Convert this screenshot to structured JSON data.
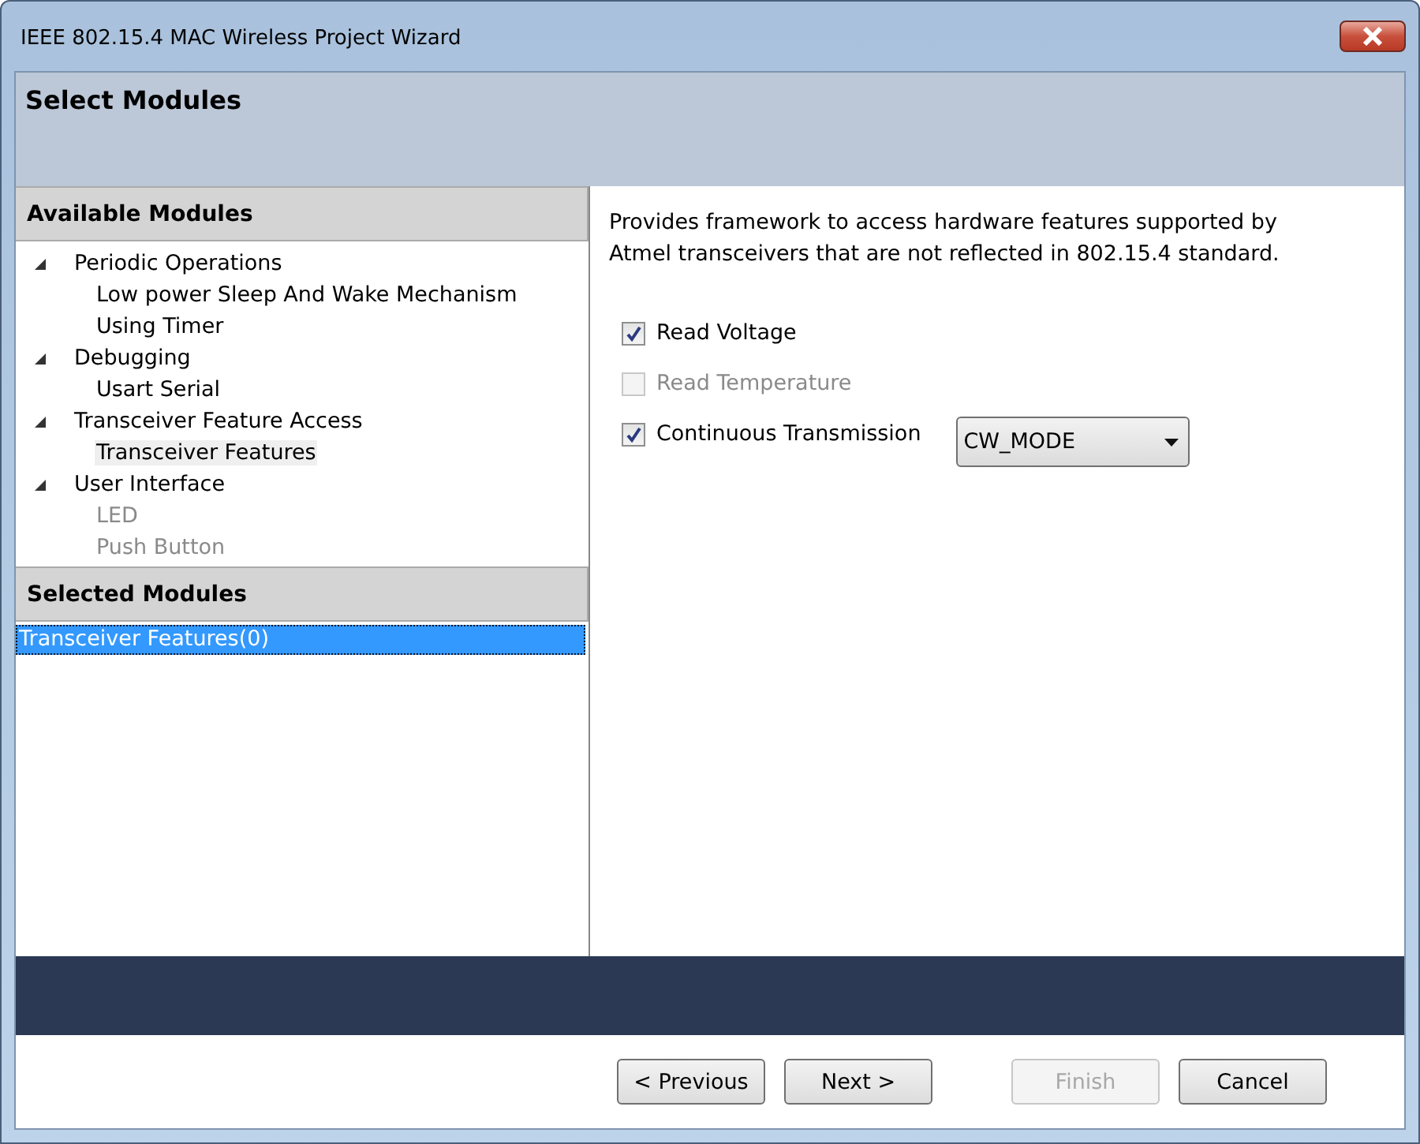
{
  "window": {
    "title": "IEEE 802.15.4 MAC Wireless Project Wizard"
  },
  "page_title": "Select Modules",
  "available_modules": {
    "title": "Available Modules",
    "items": [
      {
        "label": "Periodic Operations",
        "expanded": true,
        "children": [
          {
            "label": "Low power Sleep And Wake Mechanism",
            "disabled": false,
            "selected": false
          },
          {
            "label": "Using Timer",
            "disabled": false,
            "selected": false
          }
        ]
      },
      {
        "label": "Debugging",
        "expanded": true,
        "children": [
          {
            "label": "Usart Serial",
            "disabled": false,
            "selected": false
          }
        ]
      },
      {
        "label": "Transceiver Feature Access",
        "expanded": true,
        "children": [
          {
            "label": "Transceiver Features",
            "disabled": false,
            "selected": true
          }
        ]
      },
      {
        "label": "User Interface",
        "expanded": true,
        "children": [
          {
            "label": "LED",
            "disabled": true,
            "selected": false
          },
          {
            "label": "Push Button",
            "disabled": true,
            "selected": false
          }
        ]
      }
    ]
  },
  "selected_modules": {
    "title": "Selected Modules",
    "items": [
      {
        "label": "Transceiver Features(0)",
        "selected": true
      }
    ]
  },
  "description": "Provides framework to access hardware features supported by\nAtmel transceivers that are not reflected in 802.15.4 standard.",
  "options": [
    {
      "label": "Read Voltage",
      "checked": true,
      "disabled": false
    },
    {
      "label": "Read Temperature",
      "checked": false,
      "disabled": true
    },
    {
      "label": "Continuous Transmission",
      "checked": true,
      "disabled": false,
      "dropdown": {
        "value": "CW_MODE"
      }
    }
  ],
  "buttons": [
    {
      "label": "< Previous",
      "disabled": false
    },
    {
      "label": "Next >",
      "disabled": false
    },
    {
      "label": "Finish",
      "disabled": true
    },
    {
      "label": "Cancel",
      "disabled": false
    }
  ]
}
